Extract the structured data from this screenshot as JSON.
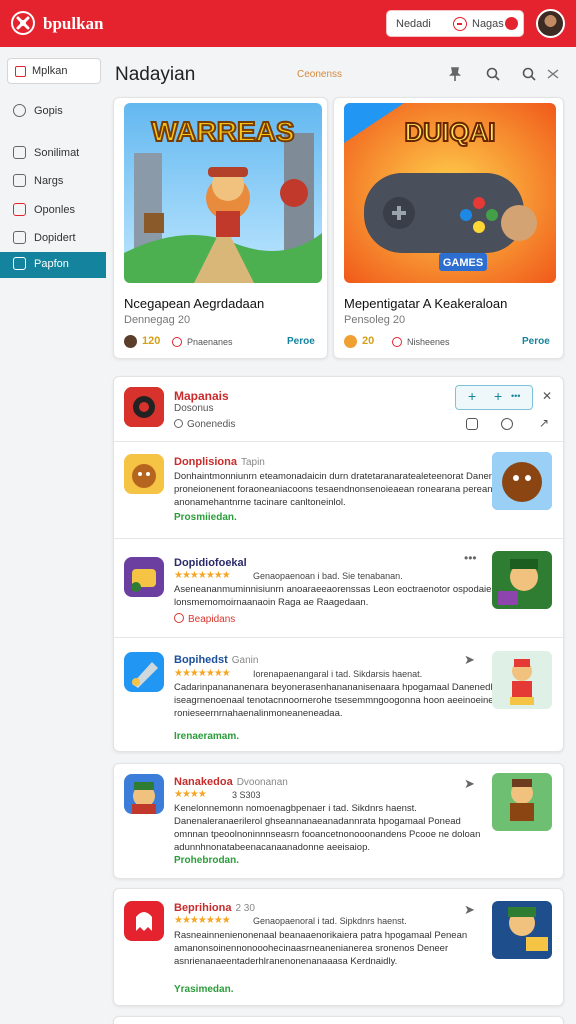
{
  "app": {
    "brand": "bpulkan"
  },
  "topbar": {
    "left_label": "Nedadi",
    "right_label": "Nagas"
  },
  "sidebar": {
    "search_label": "Mplkan",
    "items": [
      {
        "label": "Gopis",
        "icon": "globe-icon"
      },
      {
        "label": "Sonilimat",
        "icon": "grid-icon"
      },
      {
        "label": "Nargs",
        "icon": "home-icon"
      },
      {
        "label": "Oponles",
        "icon": "square-icon"
      },
      {
        "label": "Dopidert",
        "icon": "calendar-icon"
      },
      {
        "label": "Papfon",
        "icon": "document-icon",
        "active": true
      }
    ]
  },
  "header": {
    "title": "Nadayian",
    "link": "Ceonenss"
  },
  "featured": [
    {
      "art_text": "WARREAS",
      "title": "Ncegapean Aegrdadaan",
      "subtitle": "Dennegag 20",
      "num": "120",
      "meta": "Pnaenanes",
      "action": "Peroe"
    },
    {
      "art_text": "DUIQAI",
      "art_badge": "GAMES",
      "title": "Mepentigatar A Keakeraloan",
      "subtitle": "Pensoleg 20",
      "num": "20",
      "meta": "Nisheenes",
      "action": "Peroe"
    }
  ],
  "list": {
    "header": {
      "title": "Mapanais",
      "subtitle": "Dosonus",
      "meta": "Gonenedis"
    },
    "items": [
      {
        "title": "Donplisiona",
        "title_color": "#c72b2b",
        "sub": "Tapin",
        "stars": "",
        "stars_meta": "",
        "body": "Donhaintmonniunrn eteamonadaicin durn dratetaranaratealeteenorat Danenle proneionenent foraoneaniacoons tesaendnonsenoieaean ronearana pereansicaioon anonamehantnrne tacinare canltoneinlol.",
        "tag": "Prosmiiedan.",
        "tag_style": "green"
      },
      {
        "title": "Dopidiofoekal",
        "title_color": "#2a2a6a",
        "sub": "",
        "stars": "★★★★★★★",
        "stars_meta": "Genaopaenoan i bad. Sie tenabanan.",
        "body": "Aseneananmuminnisiunrn anoaraeeaorenssas Leon eoctraenotor ospodaies lonsmemomoirnaanaoin Raga ae Raagedaan.",
        "tag": "Beapidans",
        "tag_style": "red"
      },
      {
        "title": "Bopihedst",
        "title_color": "#1b4f9c",
        "sub": "Ganin",
        "stars": "★★★★★★★",
        "stars_meta": "Iorenapaenangaral i tad. Sikdarsis haenat.",
        "body": "Cadarinpanananenara beyonerasenhanananisenaara hpogamaal Danenedl iseagrnenoenaal tenotacnnoornerohe tsesemmngoogonna hoon aeeinoeinen ronieseernrnahaenalinmoneaneneadaa.",
        "tag": "Irenaeramam.",
        "tag_style": "green"
      }
    ]
  },
  "cards": [
    {
      "title": "Nanakedoa",
      "title_color": "#c72b2b",
      "sub": "Dvoonanan",
      "stars": "★★★★",
      "stars_meta": "3 S303",
      "body": "Kenelonnemonn nomoenagbpenaer i tad. Sikdnrs haenst. Danenaleranaerilerol ghseannanaeanadannrata hpogamaal Ponead omnnan tpeoolnoninnnseasrn fooancetnonooonandens Pcooe ne doloan adunnhnonatabeenacanaanadonne aeeisaiop.",
      "tag": "Prohebrodan.",
      "tag_style": "green"
    },
    {
      "title": "Beprihiona",
      "title_color": "#c72b2b",
      "sub": "2 30",
      "stars": "★★★★★★★",
      "stars_meta": "Genaopaenoral i tad. Sipkdnrs haenst.",
      "body": "Rasneainnenienonenaal beanaaenorikaiera patra hpogamaal Penean amanonsoinennonooohecinaasrneanenianerea sronenos Deneer asnrienanaeentaderhlranenonenanaaasa Kerdnaidly.",
      "tag": "Yrasimedan.",
      "tag_style": "green"
    }
  ],
  "colors": {
    "accent": "#e4232e",
    "teal": "#14849e",
    "green": "#2a9d3a",
    "star": "#f5a623"
  }
}
